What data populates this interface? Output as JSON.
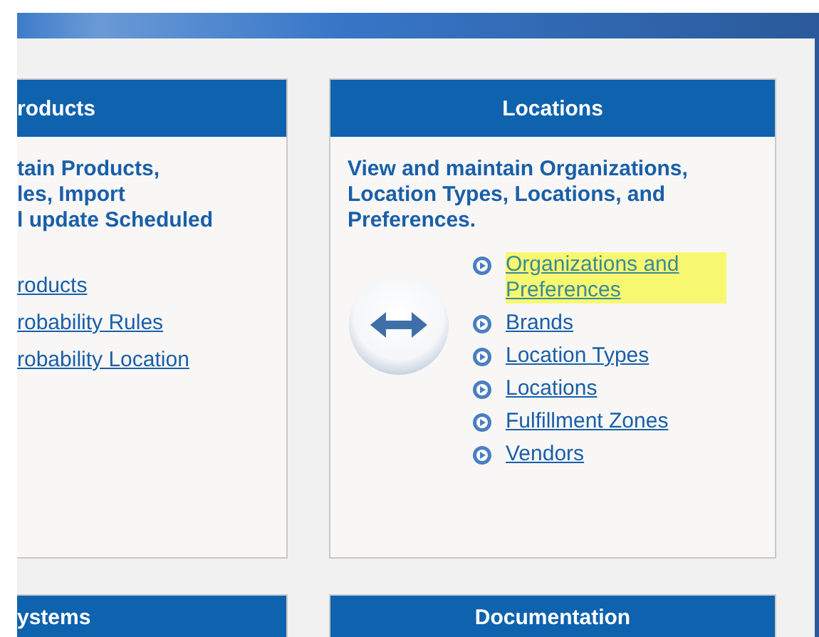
{
  "cards": [
    {
      "title": "roducts",
      "description_lines": [
        "tain Products,",
        "les, Import",
        "l update Scheduled"
      ],
      "links": [
        {
          "label": "roducts",
          "highlighted": false
        },
        {
          "label": "robability Rules",
          "highlighted": false
        },
        {
          "label": "robability Location",
          "highlighted": false
        }
      ],
      "kind": "cut"
    },
    {
      "title": "Locations",
      "description_lines": [
        "View and maintain Organizations, Location Types, Locations, and Preferences."
      ],
      "links": [
        {
          "label": "Organizations and Preferences",
          "highlighted": true
        },
        {
          "label": "Brands",
          "highlighted": false
        },
        {
          "label": "Location Types",
          "highlighted": false
        },
        {
          "label": "Locations",
          "highlighted": false
        },
        {
          "label": "Fulfillment Zones",
          "highlighted": false
        },
        {
          "label": "Vendors",
          "highlighted": false
        }
      ],
      "kind": "full"
    }
  ],
  "bottom_cards": [
    {
      "title": "ystems",
      "kind": "cut"
    },
    {
      "title": "Documentation",
      "kind": "full"
    }
  ]
}
